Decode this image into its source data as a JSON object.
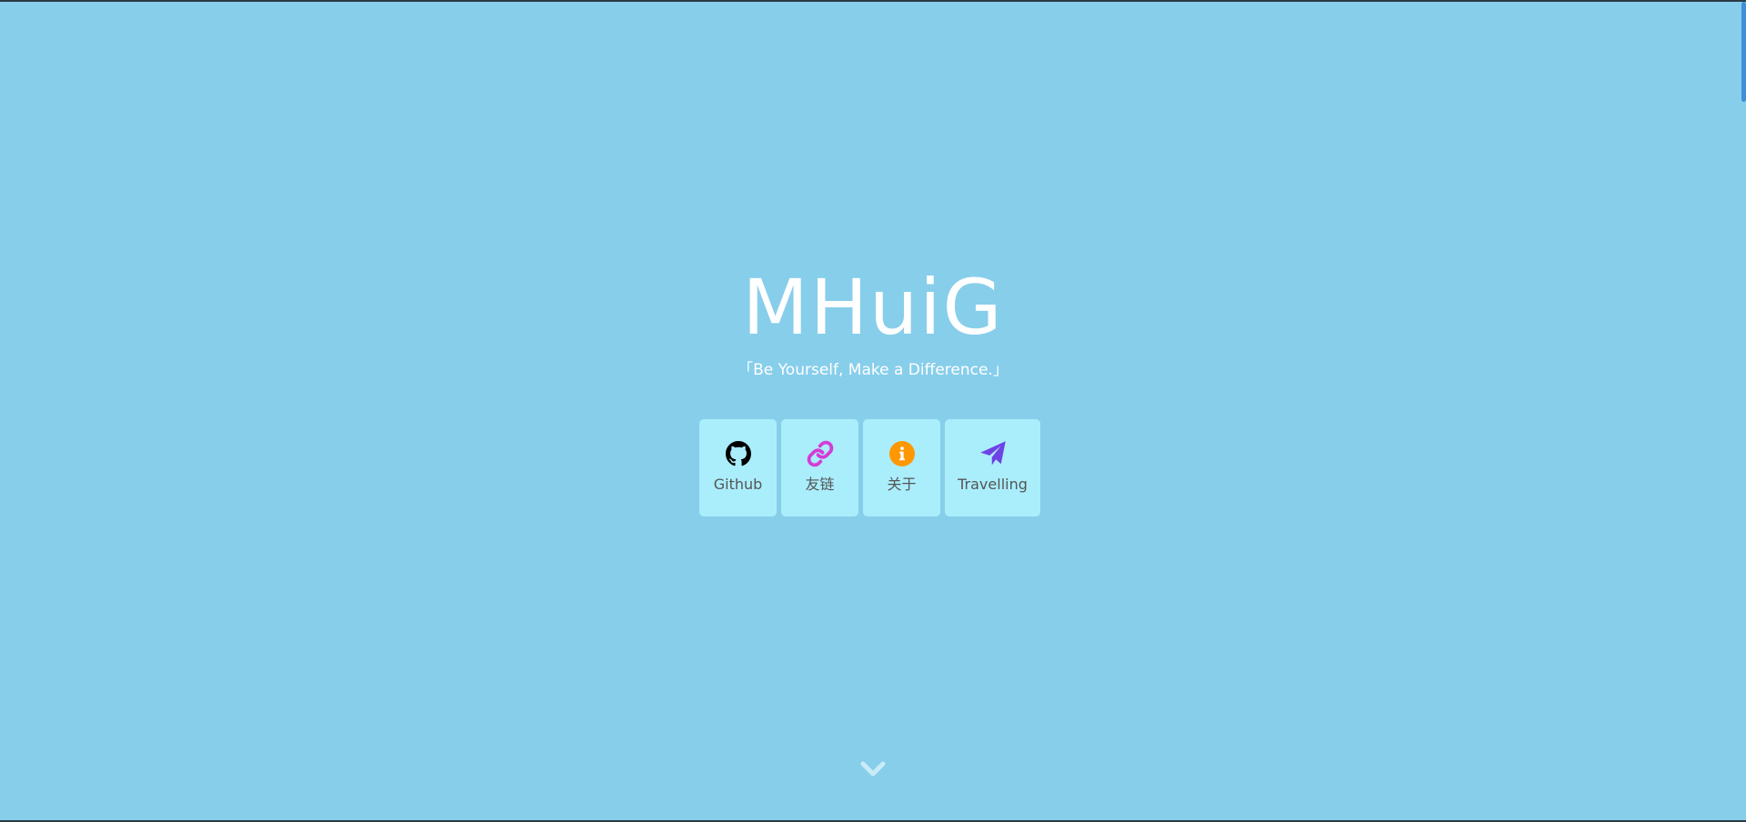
{
  "site": {
    "title": "MHuiG",
    "motto": "「Be Yourself, Make a Difference.」"
  },
  "links": [
    {
      "label": "Github",
      "icon": "github-icon",
      "color": "#000000"
    },
    {
      "label": "友链",
      "icon": "link-icon",
      "color": "#d63bd6"
    },
    {
      "label": "关于",
      "icon": "info-circle-icon",
      "color": "#ff9800"
    },
    {
      "label": "Travelling",
      "icon": "paper-plane-icon",
      "color": "#6f42e5"
    }
  ],
  "colors": {
    "background": "#87ceeb",
    "card": "#aaeefc",
    "scroll_arrow": "#c8ecf8"
  },
  "scroll_hint": {
    "icon": "chevron-down-icon"
  }
}
